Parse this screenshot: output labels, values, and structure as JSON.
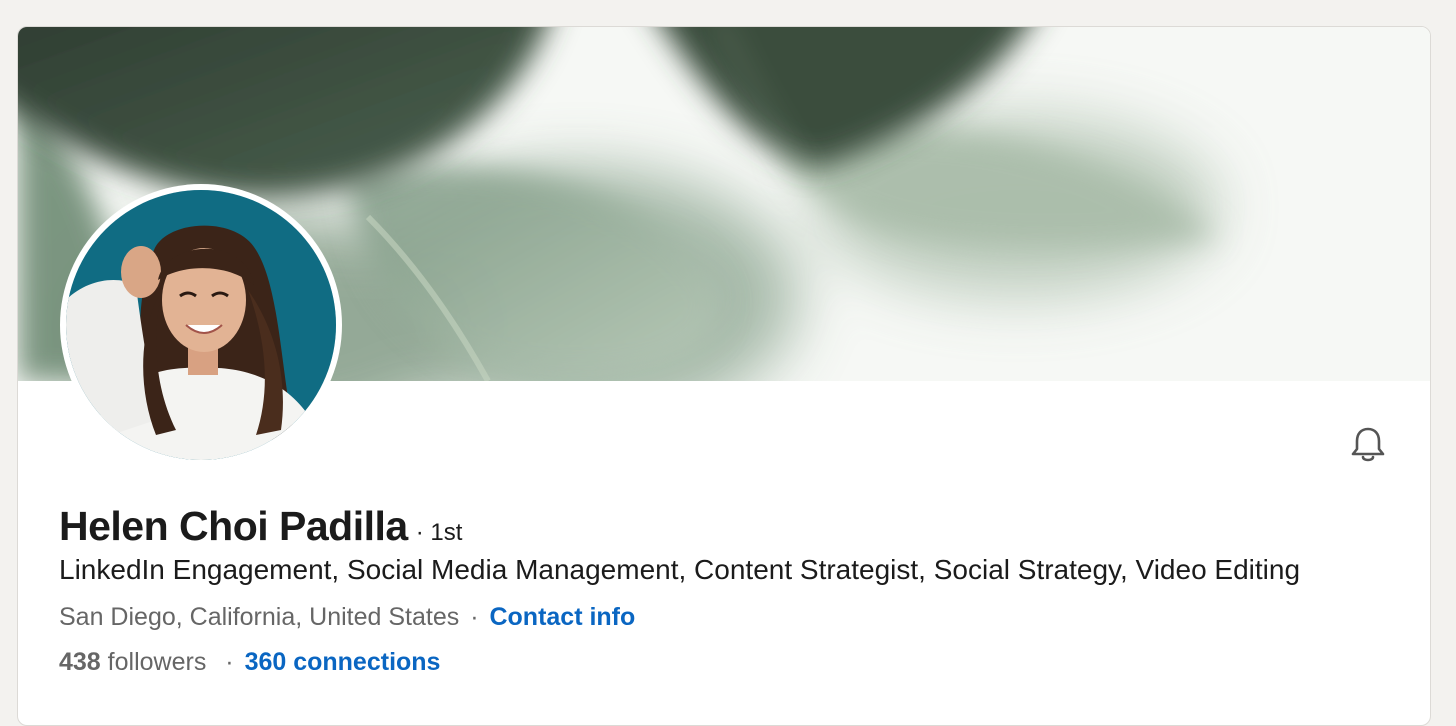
{
  "profile": {
    "name": "Helen Choi Padilla",
    "degree": "· 1st",
    "headline": "LinkedIn Engagement, Social Media Management, Content Strategist, Social Strategy, Video Editing",
    "location": "San Diego, California, United States",
    "separator": "·",
    "contact_label": "Contact info",
    "followers_count": "438",
    "followers_label": "followers",
    "connections_label": "360 connections"
  },
  "icons": {
    "bell": "bell-icon"
  },
  "colors": {
    "link": "#0a66c2",
    "page_background": "#f3f2ef",
    "banner_leaf": "#5b7a66"
  }
}
